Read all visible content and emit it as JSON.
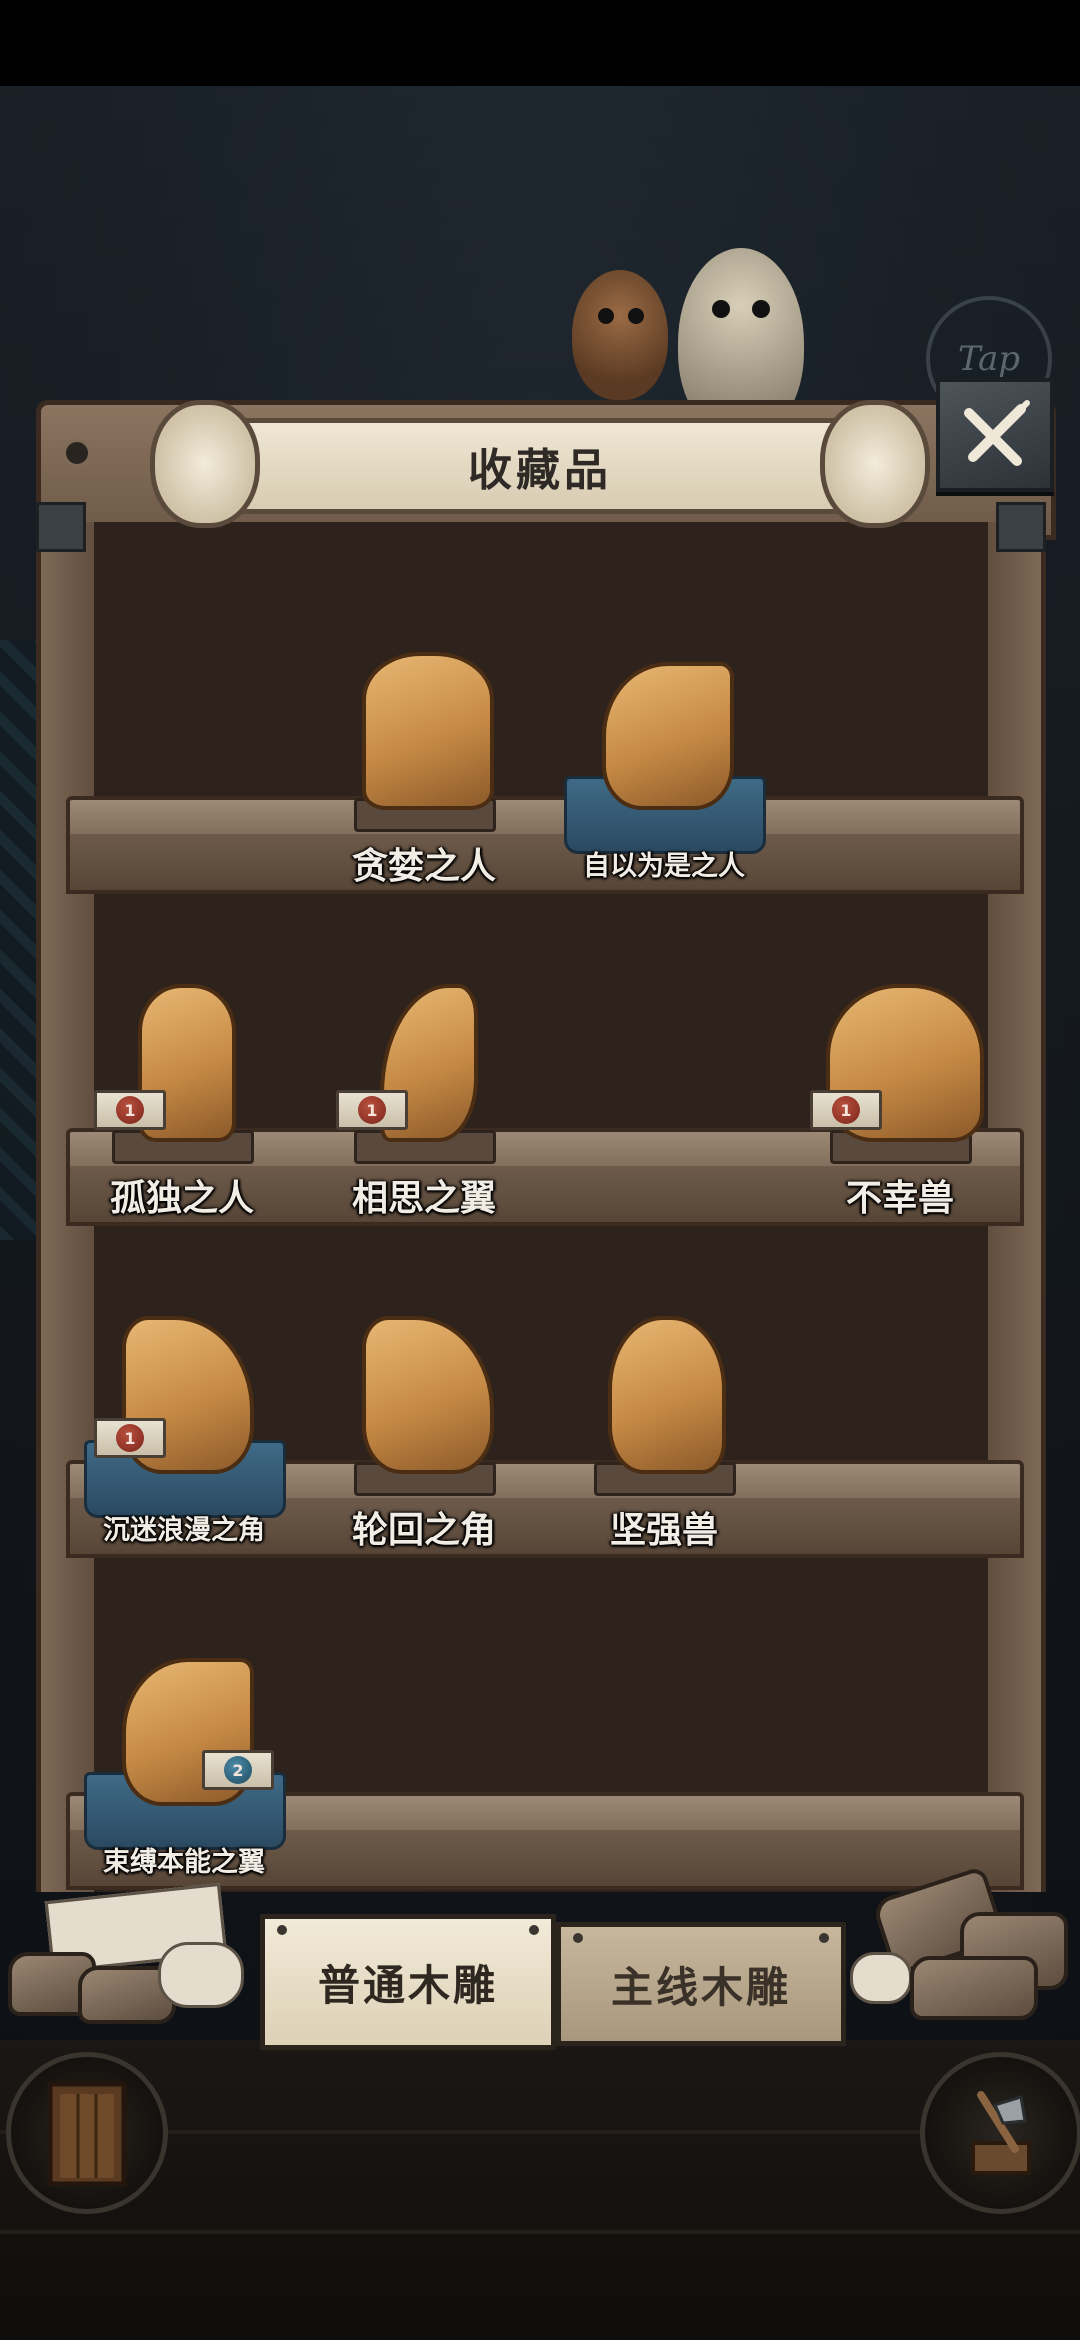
{
  "header": {
    "title": "收藏品",
    "tap_hint": "Tap"
  },
  "shelves": [
    {
      "items": [
        {
          "label": "贪婪之人",
          "count": null,
          "highlight": false,
          "shape": "person"
        },
        {
          "label": "自以为是之人",
          "count": null,
          "highlight": true,
          "shape": "tall"
        }
      ]
    },
    {
      "items": [
        {
          "label": "孤独之人",
          "count": "1",
          "highlight": false,
          "shape": "person"
        },
        {
          "label": "相思之翼",
          "count": "1",
          "highlight": false,
          "shape": "bird"
        },
        {
          "label": "不幸兽",
          "count": "1",
          "highlight": false,
          "shape": "beast"
        }
      ]
    },
    {
      "items": [
        {
          "label": "沉迷浪漫之角",
          "count": "1",
          "highlight": true,
          "shape": "horned"
        },
        {
          "label": "轮回之角",
          "count": null,
          "highlight": false,
          "shape": "horned"
        },
        {
          "label": "坚强兽",
          "count": null,
          "highlight": false,
          "shape": "beast"
        }
      ]
    },
    {
      "items": [
        {
          "label": "束缚本能之翼",
          "count": "2",
          "highlight": true,
          "shape": "tall"
        }
      ]
    }
  ],
  "tabs": [
    {
      "label": "普通木雕",
      "active": true
    },
    {
      "label": "主线木雕",
      "active": false
    }
  ],
  "icons": {
    "close": "close-x-icon",
    "door": "door-icon",
    "axe": "axe-icon"
  },
  "colors": {
    "wood": "#7f6b58",
    "highlight_pedestal": "#3f6a86",
    "figure": "#c68a45",
    "count_seal": "#7b241a"
  }
}
